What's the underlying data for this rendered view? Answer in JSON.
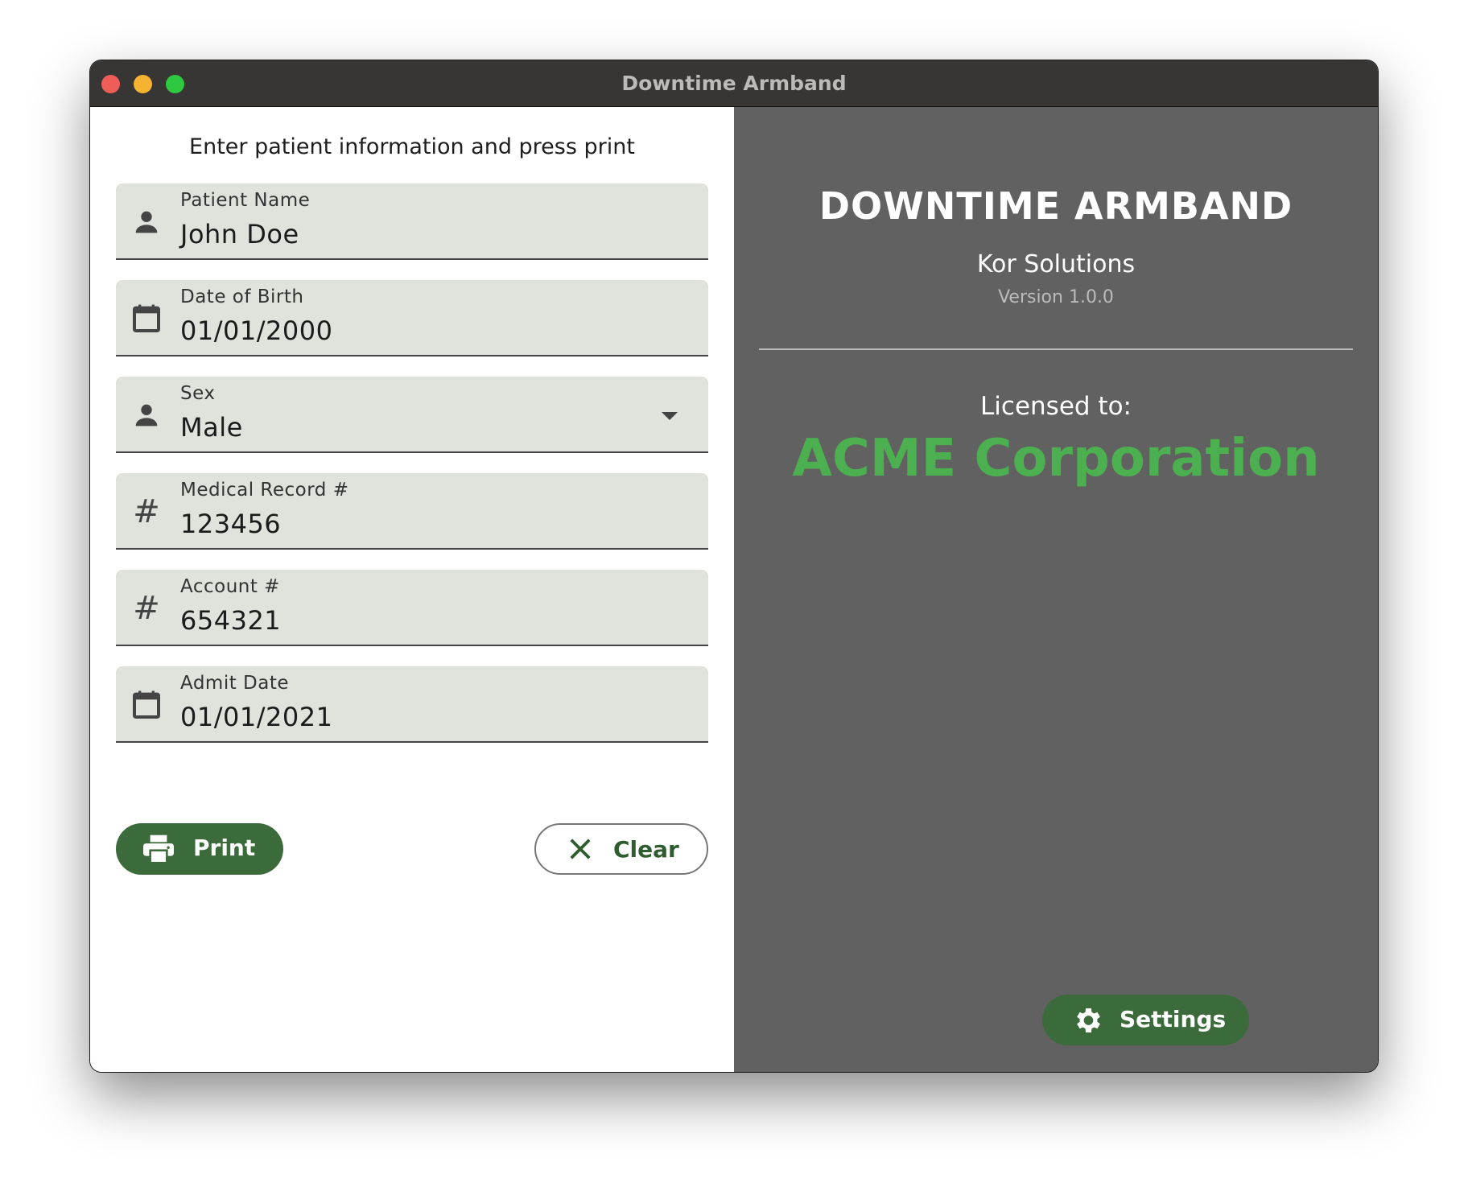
{
  "window": {
    "title": "Downtime Armband",
    "controls": {
      "close": "#ee5e56",
      "minimize": "#f6b331",
      "zoom": "#2ec940"
    }
  },
  "form": {
    "prompt": "Enter patient information and press print",
    "fields": [
      {
        "label": "Patient Name",
        "value": "John Doe",
        "icon": "person-icon"
      },
      {
        "label": "Date of Birth",
        "value": "01/01/2000",
        "icon": "calendar-icon"
      },
      {
        "label": "Sex",
        "value": "Male",
        "icon": "person-icon"
      },
      {
        "label": "Medical Record #",
        "value": "123456",
        "icon": "hash-icon"
      },
      {
        "label": "Account #",
        "value": "654321",
        "icon": "hash-icon"
      },
      {
        "label": "Admit Date",
        "value": "01/01/2021",
        "icon": "calendar-icon"
      }
    ],
    "print_label": "Print",
    "clear_label": "Clear"
  },
  "about": {
    "title": "DOWNTIME ARMBAND",
    "company": "Kor Solutions",
    "version": "Version 1.0.0",
    "licensed_label": "Licensed to:",
    "licensee": "ACME Corporation",
    "settings_label": "Settings"
  },
  "colors": {
    "accent": "#3c6b3b",
    "licensee": "#4caf50",
    "panel": "#616161"
  }
}
